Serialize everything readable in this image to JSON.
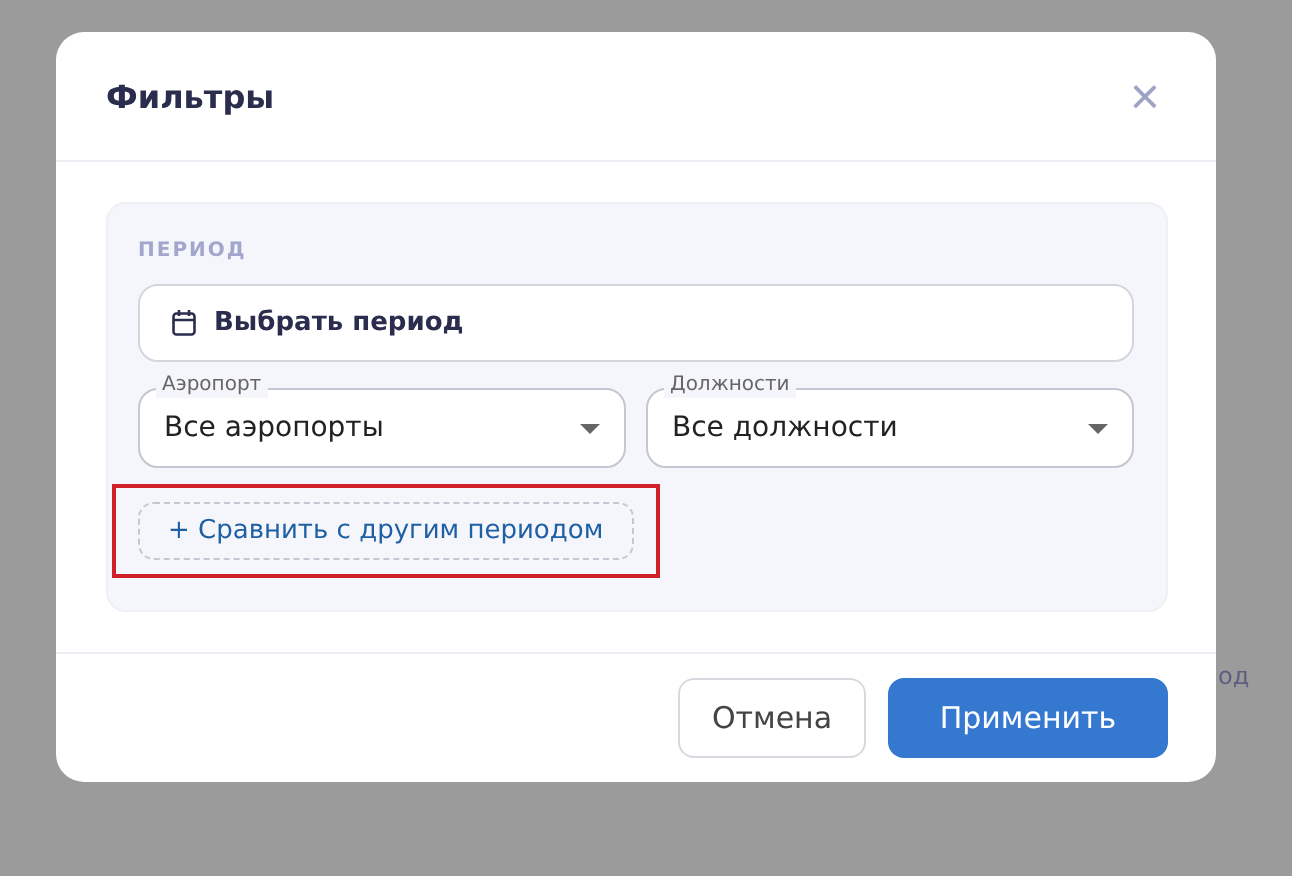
{
  "background": {
    "text": "од"
  },
  "dialog": {
    "title": "Фильтры",
    "close_icon": "×",
    "period": {
      "label": "ПЕРИОД",
      "date_button": "Выбрать период",
      "selects": [
        {
          "label": "Аэропорт",
          "value": "Все аэропорты"
        },
        {
          "label": "Должности",
          "value": "Все должности"
        }
      ],
      "compare_button": {
        "label": "+ Сравнить с другим периодом",
        "highlighted": true
      }
    },
    "buttons": [
      {
        "label": "Отмена",
        "kind": "secondary"
      },
      {
        "label": "Применить",
        "kind": "primary"
      }
    ]
  }
}
